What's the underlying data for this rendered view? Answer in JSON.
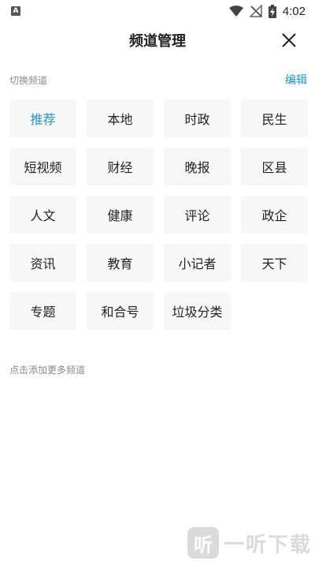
{
  "status_bar": {
    "notification_badge": "A",
    "time": "4:02",
    "icons": [
      "wifi-icon",
      "no-signal-icon",
      "battery-charging-icon"
    ]
  },
  "header": {
    "title": "频道管理",
    "close_icon": "close-icon"
  },
  "section": {
    "label": "切换频道",
    "edit_label": "编辑"
  },
  "channels": [
    {
      "label": "推荐",
      "active": true
    },
    {
      "label": "本地"
    },
    {
      "label": "时政"
    },
    {
      "label": "民生"
    },
    {
      "label": "短视频"
    },
    {
      "label": "财经"
    },
    {
      "label": "晚报"
    },
    {
      "label": "区县"
    },
    {
      "label": "人文"
    },
    {
      "label": "健康"
    },
    {
      "label": "评论"
    },
    {
      "label": "政企"
    },
    {
      "label": "资讯"
    },
    {
      "label": "教育"
    },
    {
      "label": "小记者"
    },
    {
      "label": "天下"
    },
    {
      "label": "专题"
    },
    {
      "label": "和合号"
    },
    {
      "label": "垃圾分类"
    }
  ],
  "more": {
    "label": "点击添加更多频道"
  },
  "watermark": {
    "logo_glyph": "听",
    "text": "一听下载"
  },
  "colors": {
    "accent": "#2196c9",
    "tile_bg": "#f7f7f7",
    "muted_text": "#8a8a8a"
  }
}
